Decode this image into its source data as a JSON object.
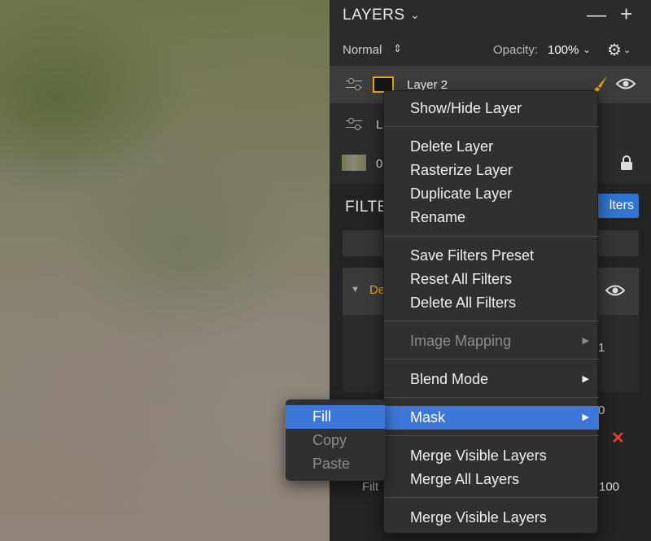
{
  "layers_panel": {
    "title": "LAYERS",
    "blend_mode": "Normal",
    "opacity_label": "Opacity:",
    "opacity_value": "100%",
    "layers": [
      {
        "name": "Layer 2"
      },
      {
        "name": "L"
      },
      {
        "name": "0"
      }
    ]
  },
  "filters_panel": {
    "title_partial": "FILTE",
    "add_button_partial": "lters",
    "filter_name_partial": "De",
    "value_a": "1",
    "value_b": "0",
    "amount_label_partial": "Filt",
    "amount_value": "100"
  },
  "context_menu": {
    "items": [
      {
        "label": "Show/Hide Layer"
      },
      {
        "label": "Delete Layer"
      },
      {
        "label": "Rasterize Layer"
      },
      {
        "label": "Duplicate Layer"
      },
      {
        "label": "Rename"
      },
      {
        "label": "Save Filters Preset"
      },
      {
        "label": "Reset All Filters"
      },
      {
        "label": "Delete All Filters"
      },
      {
        "label": "Image Mapping",
        "disabled": true
      },
      {
        "label": "Blend Mode"
      },
      {
        "label": "Mask",
        "highlighted": true
      },
      {
        "label": "Merge Visible Layers"
      },
      {
        "label": "Merge All Layers"
      },
      {
        "label": "Merge Visible Layers"
      }
    ]
  },
  "mask_submenu": {
    "items": [
      {
        "label": "Fill",
        "highlighted": true
      },
      {
        "label": "Copy",
        "disabled": true
      },
      {
        "label": "Paste",
        "disabled": true
      }
    ]
  },
  "colors": {
    "accent_blue": "#3d78d8",
    "selection_orange": "#e8a21a",
    "remove_red": "#e83a2e"
  }
}
